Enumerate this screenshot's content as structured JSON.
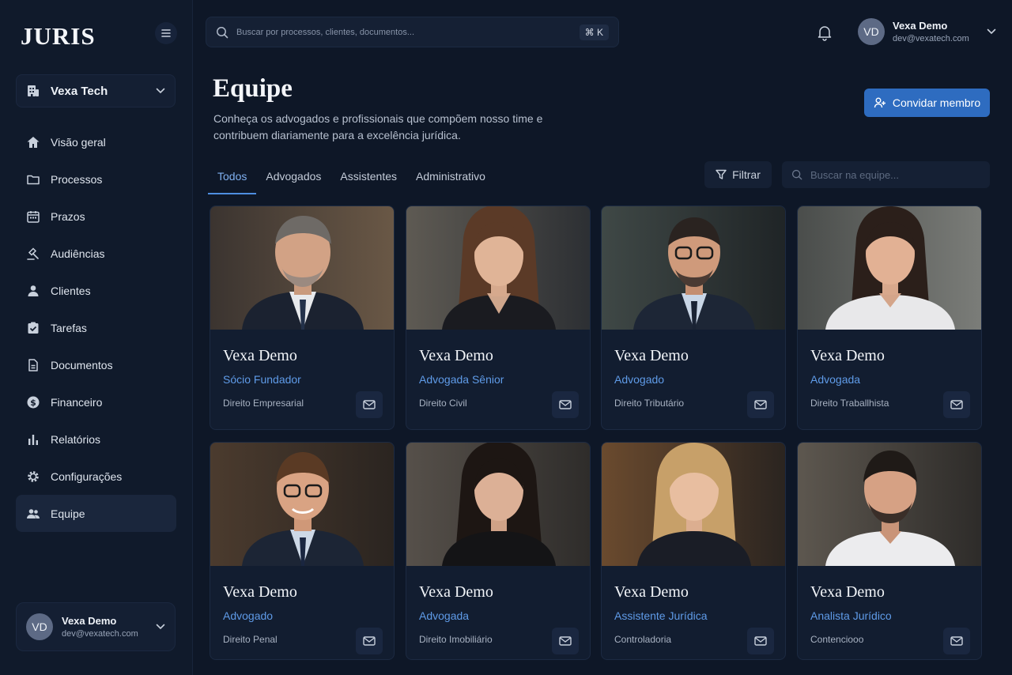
{
  "app": {
    "logo": "JURIS"
  },
  "sidebar": {
    "org": "Vexa Tech",
    "items": [
      {
        "label": "Visão geral",
        "icon": "home-icon"
      },
      {
        "label": "Processos",
        "icon": "folder-icon"
      },
      {
        "label": "Prazos",
        "icon": "calendar-icon"
      },
      {
        "label": "Audiências",
        "icon": "gavel-icon"
      },
      {
        "label": "Clientes",
        "icon": "user-icon"
      },
      {
        "label": "Tarefas",
        "icon": "clipboard-check-icon"
      },
      {
        "label": "Documentos",
        "icon": "document-icon"
      },
      {
        "label": "Financeiro",
        "icon": "dollar-icon"
      },
      {
        "label": "Relatórios",
        "icon": "bar-chart-icon"
      },
      {
        "label": "Configurações",
        "icon": "gear-icon"
      },
      {
        "label": "Equipe",
        "icon": "users-icon",
        "active": true
      }
    ],
    "user": {
      "initials": "VD",
      "name": "Vexa Demo",
      "email": "dev@vexatech.com"
    }
  },
  "topbar": {
    "search_placeholder": "Buscar por processos, clientes, documentos...",
    "shortcut": "⌘ K",
    "user": {
      "initials": "VD",
      "name": "Vexa Demo",
      "email": "dev@vexatech.com"
    }
  },
  "header": {
    "title": "Equipe",
    "subtitle": "Conheça os advogados e profissionais que compõem nosso time e contribuem diariamente para a excelência jurídica.",
    "invite_label": "Convidar membro"
  },
  "tabs": [
    {
      "label": "Todos",
      "active": true
    },
    {
      "label": "Advogados"
    },
    {
      "label": "Assistentes"
    },
    {
      "label": "Administrativo"
    }
  ],
  "filter_label": "Filtrar",
  "team_search_placeholder": "Buscar na equipe...",
  "members": [
    {
      "name": "Vexa Demo",
      "role": "Sócio Fundador",
      "area": "Direito Empresarial"
    },
    {
      "name": "Vexa Demo",
      "role": "Advogada Sênior",
      "area": "Direito Civil"
    },
    {
      "name": "Vexa Demo",
      "role": "Advogado",
      "area": "Direito Tributário"
    },
    {
      "name": "Vexa Demo",
      "role": "Advogada",
      "area": "Direito Traballhista"
    },
    {
      "name": "Vexa Demo",
      "role": "Advogado",
      "area": "Direito Penal"
    },
    {
      "name": "Vexa Demo",
      "role": "Advogada",
      "area": "Direito Imobiliário"
    },
    {
      "name": "Vexa Demo",
      "role": "Assistente Jurídica",
      "area": "Controladoria"
    },
    {
      "name": "Vexa Demo",
      "role": "Analista Jurídico",
      "area": "Contencioοo"
    }
  ],
  "colors": {
    "accent": "#2e6cc0",
    "role_text": "#5f9be8",
    "background": "#0e1727"
  }
}
